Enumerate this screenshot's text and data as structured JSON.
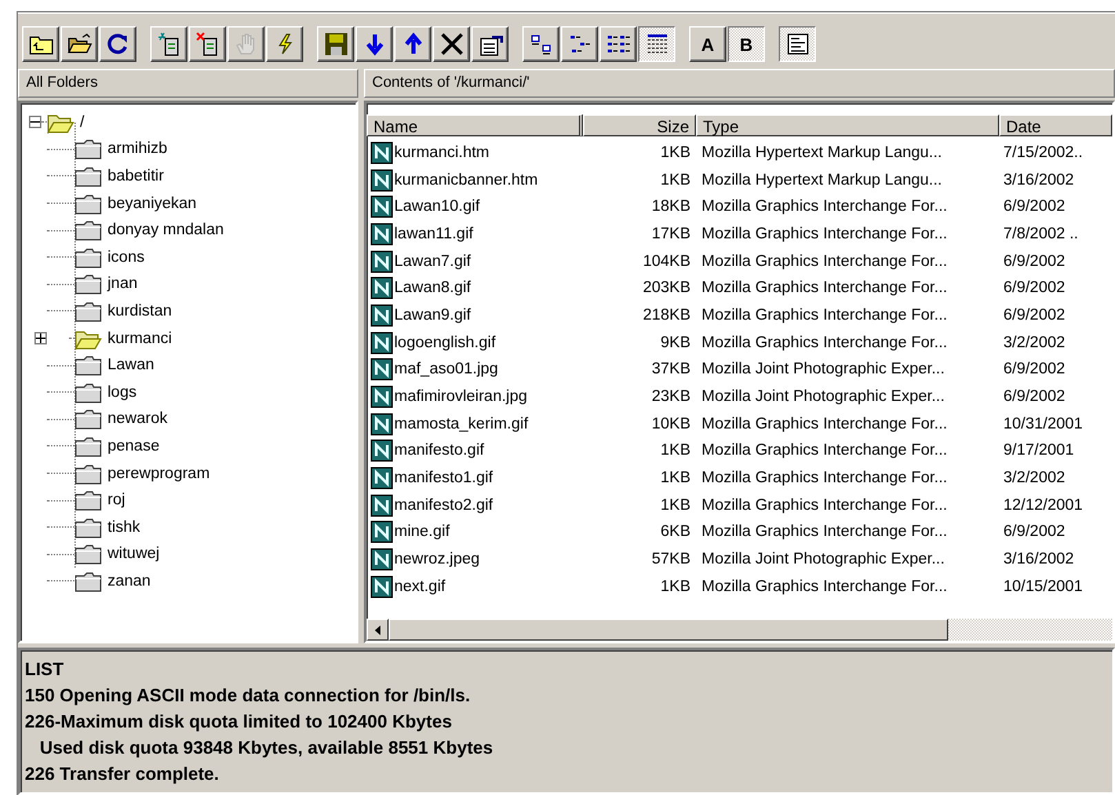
{
  "toolbar": {
    "groups": [
      {
        "buttons": [
          {
            "kind": "upfolder",
            "pressed": false,
            "disabled": false
          },
          {
            "kind": "openfolder",
            "pressed": false,
            "disabled": false
          },
          {
            "kind": "refresh",
            "pressed": false,
            "disabled": false
          }
        ]
      },
      {
        "buttons": [
          {
            "kind": "newfile",
            "pressed": false,
            "disabled": false
          },
          {
            "kind": "deletefile",
            "pressed": false,
            "disabled": false
          },
          {
            "kind": "hand",
            "pressed": false,
            "disabled": true
          },
          {
            "kind": "lightning",
            "pressed": false,
            "disabled": false
          }
        ]
      },
      {
        "buttons": [
          {
            "kind": "save",
            "pressed": false,
            "disabled": false
          },
          {
            "kind": "download",
            "pressed": false,
            "disabled": false
          },
          {
            "kind": "upload",
            "pressed": false,
            "disabled": false
          },
          {
            "kind": "delete",
            "pressed": false,
            "disabled": false
          },
          {
            "kind": "properties",
            "pressed": false,
            "disabled": false
          }
        ]
      },
      {
        "buttons": [
          {
            "kind": "largeicons",
            "pressed": false,
            "disabled": false
          },
          {
            "kind": "smallicons",
            "pressed": false,
            "disabled": false
          },
          {
            "kind": "list",
            "pressed": false,
            "disabled": false
          },
          {
            "kind": "details",
            "pressed": true,
            "disabled": false
          }
        ]
      },
      {
        "buttons": [
          {
            "kind": "text",
            "label": "A",
            "pressed": false,
            "disabled": false
          },
          {
            "kind": "text",
            "label": "B",
            "pressed": true,
            "disabled": false
          }
        ]
      },
      {
        "buttons": [
          {
            "kind": "log",
            "pressed": true,
            "disabled": false
          }
        ]
      }
    ]
  },
  "folders_panel": {
    "title": "All Folders",
    "tree": {
      "label": "/",
      "expanded": true,
      "children": [
        {
          "label": "armihizb",
          "expandable": false,
          "current": false
        },
        {
          "label": "babetitir",
          "expandable": false,
          "current": false
        },
        {
          "label": "beyaniyekan",
          "expandable": false,
          "current": false
        },
        {
          "label": "donyay mndalan",
          "expandable": false,
          "current": false
        },
        {
          "label": "icons",
          "expandable": false,
          "current": false
        },
        {
          "label": "jnan",
          "expandable": false,
          "current": false
        },
        {
          "label": "kurdistan",
          "expandable": false,
          "current": false
        },
        {
          "label": "kurmanci",
          "expandable": true,
          "current": true
        },
        {
          "label": "Lawan",
          "expandable": false,
          "current": false
        },
        {
          "label": "logs",
          "expandable": false,
          "current": false
        },
        {
          "label": "newarok",
          "expandable": false,
          "current": false
        },
        {
          "label": "penase",
          "expandable": false,
          "current": false
        },
        {
          "label": "perewprogram",
          "expandable": false,
          "current": false
        },
        {
          "label": "roj",
          "expandable": false,
          "current": false
        },
        {
          "label": "tishk",
          "expandable": false,
          "current": false
        },
        {
          "label": "wituwej",
          "expandable": false,
          "current": false
        },
        {
          "label": "zanan",
          "expandable": false,
          "current": false
        }
      ]
    }
  },
  "contents_panel": {
    "title": "Contents of '/kurmanci/'",
    "table": {
      "columns": [
        "Name",
        "Size",
        "Type",
        "Date"
      ],
      "rows": [
        {
          "name": "kurmanci.htm",
          "size": "1KB",
          "type": "Mozilla Hypertext Markup Langu...",
          "date": "7/15/2002.."
        },
        {
          "name": "kurmanicbanner.htm",
          "size": "1KB",
          "type": "Mozilla Hypertext Markup Langu...",
          "date": "3/16/2002"
        },
        {
          "name": "Lawan10.gif",
          "size": "18KB",
          "type": "Mozilla Graphics Interchange For...",
          "date": "6/9/2002"
        },
        {
          "name": "lawan11.gif",
          "size": "17KB",
          "type": "Mozilla Graphics Interchange For...",
          "date": "7/8/2002 .."
        },
        {
          "name": "Lawan7.gif",
          "size": "104KB",
          "type": "Mozilla Graphics Interchange For...",
          "date": "6/9/2002"
        },
        {
          "name": "Lawan8.gif",
          "size": "203KB",
          "type": "Mozilla Graphics Interchange For...",
          "date": "6/9/2002"
        },
        {
          "name": "Lawan9.gif",
          "size": "218KB",
          "type": "Mozilla Graphics Interchange For...",
          "date": "6/9/2002"
        },
        {
          "name": "logoenglish.gif",
          "size": "9KB",
          "type": "Mozilla Graphics Interchange For...",
          "date": "3/2/2002"
        },
        {
          "name": "maf_aso01.jpg",
          "size": "37KB",
          "type": "Mozilla Joint Photographic Exper...",
          "date": "6/9/2002"
        },
        {
          "name": "mafimirovleiran.jpg",
          "size": "23KB",
          "type": "Mozilla Joint Photographic Exper...",
          "date": "6/9/2002"
        },
        {
          "name": "mamosta_kerim.gif",
          "size": "10KB",
          "type": "Mozilla Graphics Interchange For...",
          "date": "10/31/2001"
        },
        {
          "name": "manifesto.gif",
          "size": "1KB",
          "type": "Mozilla Graphics Interchange For...",
          "date": "9/17/2001"
        },
        {
          "name": "manifesto1.gif",
          "size": "1KB",
          "type": "Mozilla Graphics Interchange For...",
          "date": "3/2/2002"
        },
        {
          "name": "manifesto2.gif",
          "size": "1KB",
          "type": "Mozilla Graphics Interchange For...",
          "date": "12/12/2001"
        },
        {
          "name": "mine.gif",
          "size": "6KB",
          "type": "Mozilla Graphics Interchange For...",
          "date": "6/9/2002"
        },
        {
          "name": "newroz.jpeg",
          "size": "57KB",
          "type": "Mozilla Joint Photographic Exper...",
          "date": "3/16/2002"
        },
        {
          "name": "next.gif",
          "size": "1KB",
          "type": "Mozilla Graphics Interchange For...",
          "date": "10/15/2001"
        }
      ]
    }
  },
  "log": [
    "LIST",
    "150 Opening ASCII mode data connection for /bin/ls.",
    "226-Maximum disk quota limited to 102400 Kbytes",
    "   Used disk quota 93848 Kbytes, available 8551 Kbytes",
    "226 Transfer complete."
  ]
}
